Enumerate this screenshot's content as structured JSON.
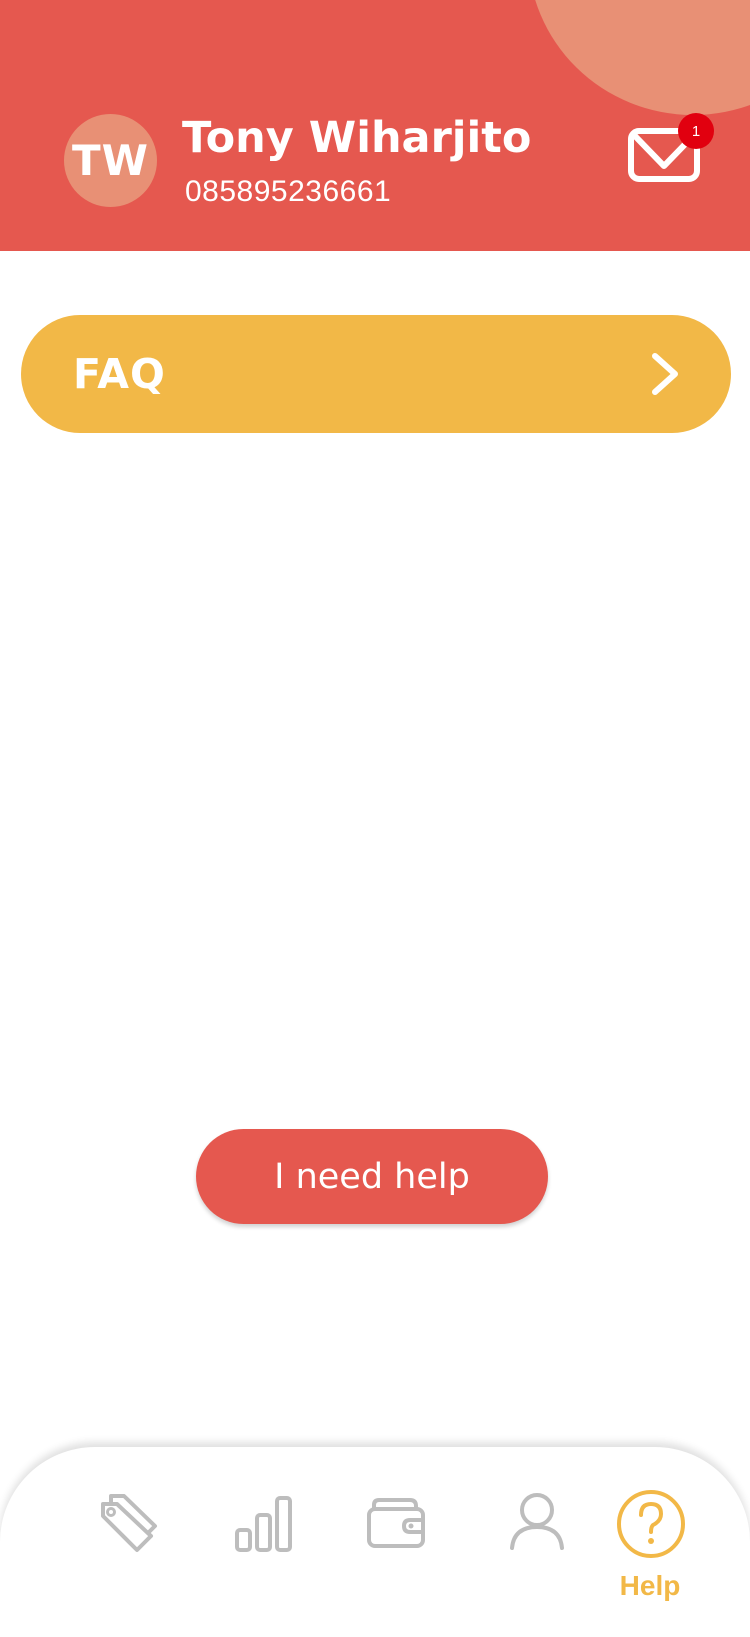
{
  "header": {
    "avatar_initials": "TW",
    "user_name": "Tony Wiharjito",
    "phone": "085895236661",
    "mail_icon": "envelope-icon",
    "unread_count": "1"
  },
  "main": {
    "faq_label": "FAQ",
    "faq_icon": "chevron-right-icon",
    "help_button_label": "I need help"
  },
  "bottom_nav": {
    "items": [
      {
        "icon": "tags-icon"
      },
      {
        "icon": "bar-chart-icon"
      },
      {
        "icon": "wallet-icon"
      },
      {
        "icon": "user-icon"
      },
      {
        "icon": "help-icon",
        "label": "Help",
        "active": true
      }
    ]
  },
  "colors": {
    "primary": "#E5584F",
    "accent": "#F2B847",
    "avatar_bg": "#E89075",
    "badge": "#E1000F",
    "inactive_icon": "#BDBDBD"
  }
}
